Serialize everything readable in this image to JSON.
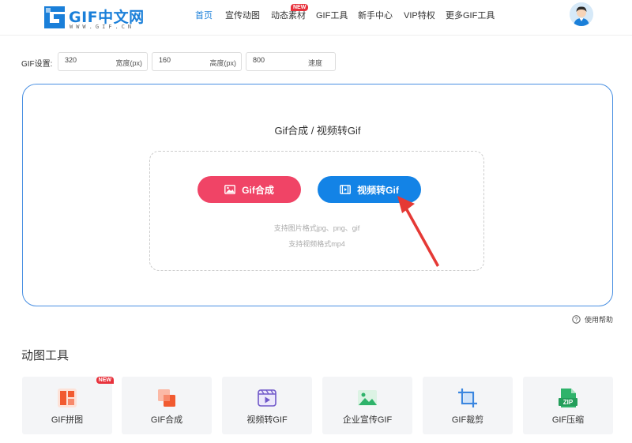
{
  "logo": {
    "text": "GIF中文网",
    "sub": "WWW.GIF.CN"
  },
  "nav": [
    {
      "label": "首页",
      "active": true
    },
    {
      "label": "宣传动图"
    },
    {
      "label": "动态素材",
      "badge": "NEW"
    },
    {
      "label": "GIF工具"
    },
    {
      "label": "新手中心"
    },
    {
      "label": "VIP特权"
    },
    {
      "label": "更多GIF工具"
    }
  ],
  "settings": {
    "label": "GIF设置:",
    "width": {
      "value": "320",
      "unit": "宽度(px)"
    },
    "height": {
      "value": "160",
      "unit": "高度(px)"
    },
    "speed": {
      "value": "800",
      "unit": "速度"
    }
  },
  "upload": {
    "title": "Gif合成 / 视频转Gif",
    "btn_gif": "Gif合成",
    "btn_video": "视频转Gif",
    "hint_image": "支持图片格式jpg、png、gif",
    "hint_video": "支持视频格式mp4"
  },
  "help": "使用帮助",
  "tools_title": "动图工具",
  "tools": [
    {
      "label": "GIF拼图",
      "badge": "NEW",
      "icon": "puzzle-icon"
    },
    {
      "label": "GIF合成",
      "icon": "merge-icon"
    },
    {
      "label": "视频转GIF",
      "icon": "video-icon"
    },
    {
      "label": "企业宣传GIF",
      "icon": "picture-icon"
    },
    {
      "label": "GIF裁剪",
      "icon": "crop-icon"
    },
    {
      "label": "GIF压缩",
      "icon": "zip-icon"
    }
  ],
  "colors": {
    "brand": "#1a7fd9",
    "pink": "#f04466",
    "blue": "#1383e6",
    "arrow": "#e53935"
  }
}
